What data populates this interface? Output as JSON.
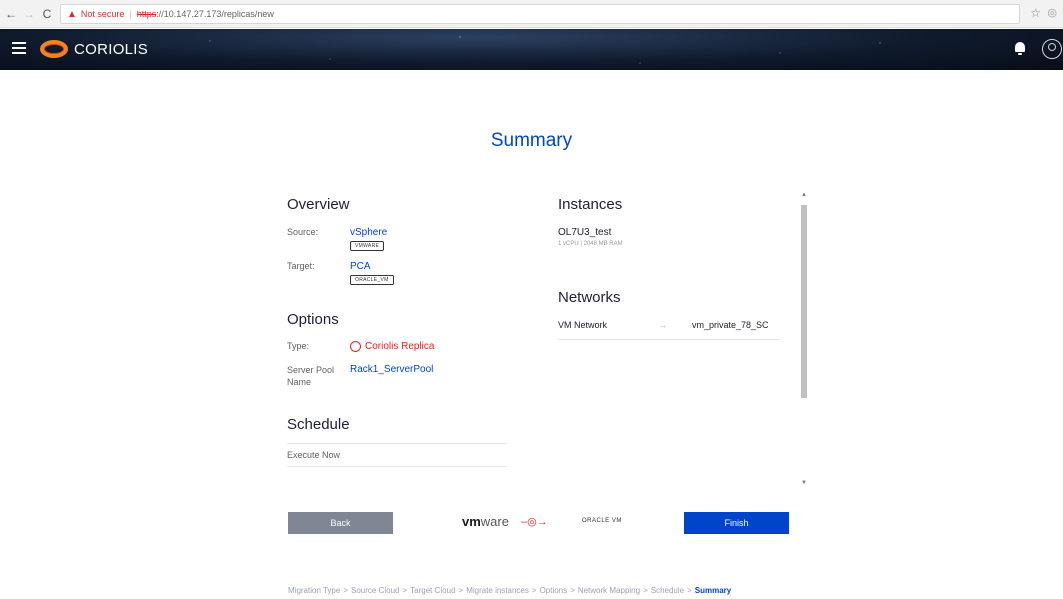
{
  "browser": {
    "not_secure": "Not secure",
    "url_scheme": "https",
    "url_rest": "://10.147.27.173/replicas/new"
  },
  "header": {
    "brand": "CORIOLIS"
  },
  "page": {
    "title": "Summary"
  },
  "overview": {
    "title": "Overview",
    "source_label": "Source:",
    "source_value": "vSphere",
    "source_tag": "VMWARE",
    "target_label": "Target:",
    "target_value": "PCA",
    "target_tag": "ORACLE_VM"
  },
  "options": {
    "title": "Options",
    "type_label": "Type:",
    "type_value": "Coriolis Replica",
    "pool_label": "Server Pool Name",
    "pool_value": "Rack1_ServerPool"
  },
  "schedule": {
    "title": "Schedule",
    "value": "Execute Now"
  },
  "instances": {
    "title": "Instances",
    "items": [
      {
        "name": "OL7U3_test",
        "details": "1 vCPU | 2048 MB RAM"
      }
    ]
  },
  "networks": {
    "title": "Networks",
    "items": [
      {
        "source": "VM Network",
        "arrow": "→",
        "target": "vm_private_78_SC"
      }
    ]
  },
  "footer": {
    "back_label": "Back",
    "finish_label": "Finish",
    "source_logo_vm": "vm",
    "source_logo_ware": "ware",
    "target_logo": "ORACLE VM"
  },
  "breadcrumb": {
    "steps": [
      "Migration Type",
      "Source Cloud",
      "Target Cloud",
      "Migrate instances",
      "Options",
      "Network Mapping",
      "Schedule",
      "Summary"
    ],
    "active_index": 7
  },
  "colors": {
    "accent": "#0044ca",
    "replica_red": "#e62424",
    "back_button": "#7f8795"
  }
}
